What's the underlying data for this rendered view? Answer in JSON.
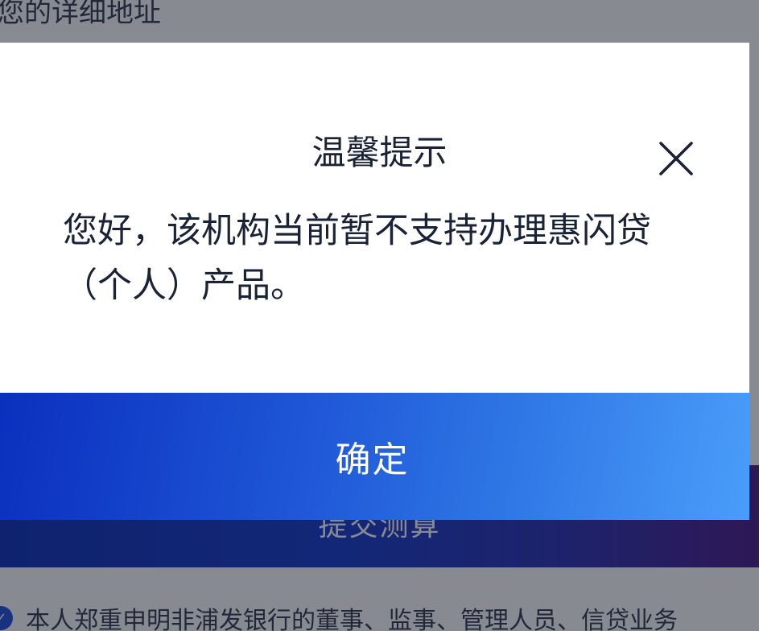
{
  "background": {
    "address_label": "您的详细地址",
    "submit_label": "提交测算",
    "declaration_text": "本人郑重申明非浦发银行的董事、监事、管理人员、信贷业务"
  },
  "dialog": {
    "title": "温馨提示",
    "close_icon": "close-icon",
    "message": "您好，该机构当前暂不支持办理惠闪贷（个人）产品。",
    "confirm_label": "确定"
  },
  "colors": {
    "overlay": "#121626",
    "title_text": "#1a2236",
    "button_gradient_start": "#0a2fbe",
    "button_gradient_end": "#4a9dfa"
  }
}
